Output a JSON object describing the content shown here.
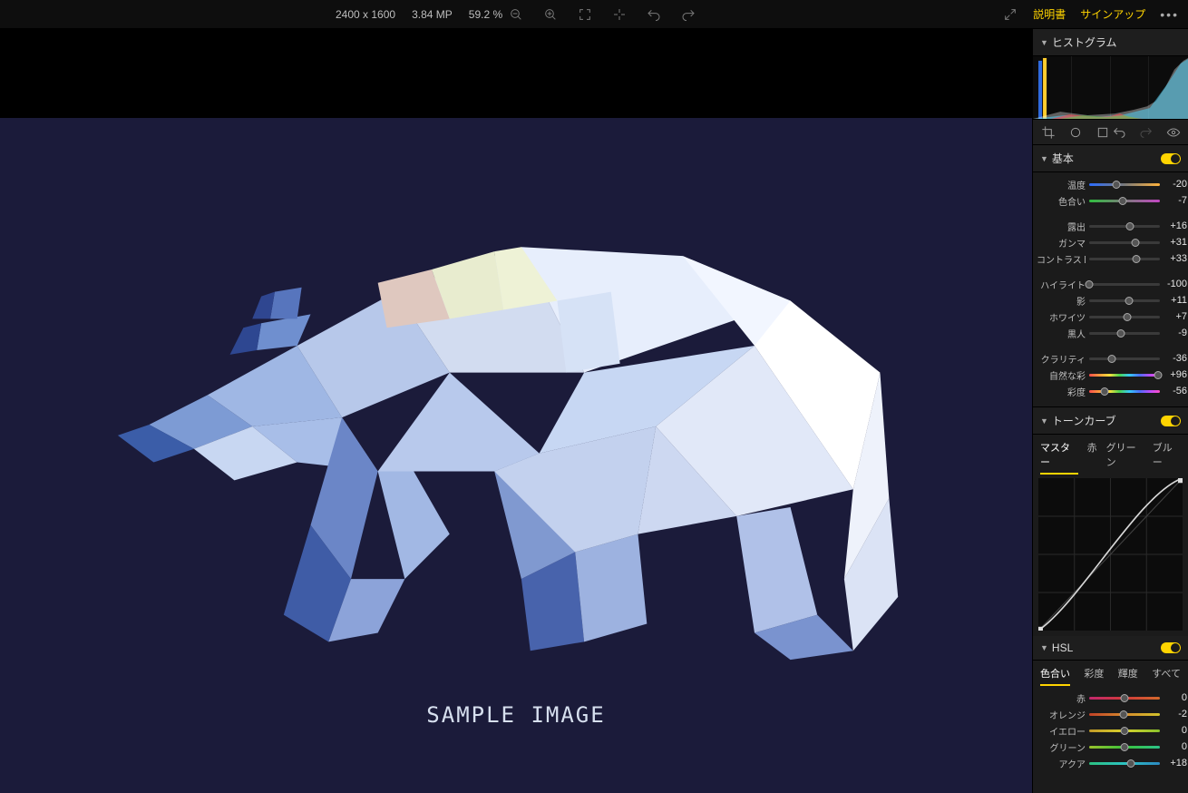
{
  "topbar": {
    "dimensions": "2400 x 1600",
    "megapixels": "3.84 MP",
    "zoom": "59.2 %",
    "manual": "説明書",
    "signup": "サインアップ"
  },
  "canvas": {
    "sample_label": "SAMPLE IMAGE"
  },
  "panel": {
    "histogram": {
      "title": "ヒストグラム"
    },
    "basic": {
      "title": "基本",
      "temperature": {
        "label": "温度",
        "value": "-20",
        "pos": 38,
        "track": "by"
      },
      "tint": {
        "label": "色合い",
        "value": "-7",
        "pos": 47,
        "track": "gm"
      },
      "exposure": {
        "label": "露出",
        "value": "+16",
        "pos": 58,
        "track": "plain"
      },
      "gamma": {
        "label": "ガンマ",
        "value": "+31",
        "pos": 66,
        "track": "plain"
      },
      "contrast": {
        "label": "コントラスト",
        "value": "+33",
        "pos": 67,
        "track": "plain"
      },
      "highlight": {
        "label": "ハイライト",
        "value": "-100",
        "pos": 0,
        "track": "plain"
      },
      "shadow": {
        "label": "影",
        "value": "+11",
        "pos": 56,
        "track": "plain"
      },
      "whites": {
        "label": "ホワイツ",
        "value": "+7",
        "pos": 54,
        "track": "plain"
      },
      "blacks": {
        "label": "黒人",
        "value": "-9",
        "pos": 45,
        "track": "plain"
      },
      "clarity": {
        "label": "クラリティ",
        "value": "-36",
        "pos": 32,
        "track": "plain"
      },
      "vibrance": {
        "label": "自然な彩",
        "value": "+96",
        "pos": 98,
        "track": "rainbow"
      },
      "saturation": {
        "label": "彩度",
        "value": "-56",
        "pos": 22,
        "track": "rainbow"
      }
    },
    "tone_curve": {
      "title": "トーンカーブ",
      "tabs": [
        "マスター",
        "赤",
        "グリーン",
        "ブルー"
      ]
    },
    "hsl": {
      "title": "HSL",
      "tabs": [
        "色合い",
        "彩度",
        "輝度",
        "すべて"
      ],
      "red": {
        "label": "赤",
        "value": "0",
        "pos": 50,
        "track": "hue-red"
      },
      "orange": {
        "label": "オレンジ",
        "value": "-2",
        "pos": 49,
        "track": "hue-orange"
      },
      "yellow": {
        "label": "イエロー",
        "value": "0",
        "pos": 50,
        "track": "hue-yellow"
      },
      "green": {
        "label": "グリーン",
        "value": "0",
        "pos": 50,
        "track": "hue-green"
      },
      "aqua": {
        "label": "アクア",
        "value": "+18",
        "pos": 59,
        "track": "hue-aqua"
      }
    }
  }
}
